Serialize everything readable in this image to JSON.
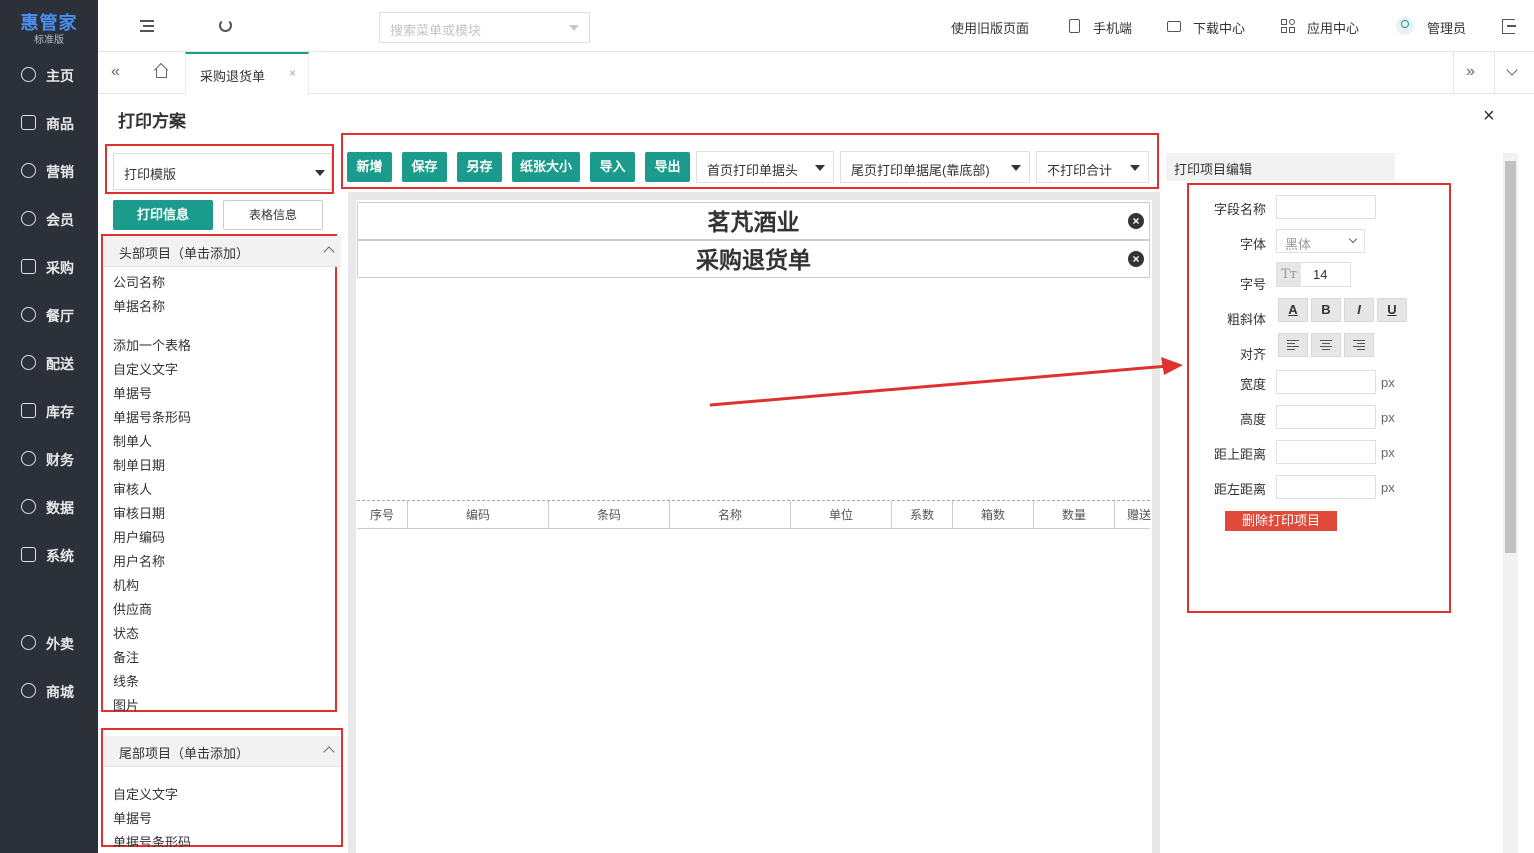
{
  "app": {
    "logo": "惠管家",
    "edition": "标准版"
  },
  "nav": [
    {
      "label": "主页",
      "icon": "home-icon"
    },
    {
      "label": "商品",
      "icon": "box-icon"
    },
    {
      "label": "营销",
      "icon": "marketing-icon"
    },
    {
      "label": "会员",
      "icon": "heart-icon"
    },
    {
      "label": "采购",
      "icon": "purchase-icon"
    },
    {
      "label": "餐厅",
      "icon": "restaurant-icon"
    },
    {
      "label": "配送",
      "icon": "delivery-icon"
    },
    {
      "label": "库存",
      "icon": "inventory-icon"
    },
    {
      "label": "财务",
      "icon": "finance-icon"
    },
    {
      "label": "数据",
      "icon": "chart-icon"
    },
    {
      "label": "系统",
      "icon": "settings-icon"
    },
    {
      "label": "外卖",
      "icon": "takeout-icon"
    },
    {
      "label": "商城",
      "icon": "store-icon"
    }
  ],
  "topbar": {
    "search_placeholder": "搜索菜单或模块",
    "old_version": "使用旧版页面",
    "mobile": "手机端",
    "download": "下载中心",
    "apps": "应用中心",
    "user": "管理员"
  },
  "tabs": {
    "active": "采购退货单",
    "close": "×"
  },
  "dialog": {
    "title": "打印方案",
    "close": "×",
    "template_select": "打印模版",
    "print_info_btn": "打印信息",
    "table_info_btn": "表格信息",
    "header_section": "头部项目（单击添加）",
    "header_items": [
      "公司名称",
      "单据名称",
      "添加一个表格",
      "自定义文字",
      "单据号",
      "单据号条形码",
      "制单人",
      "制单日期",
      "审核人",
      "审核日期",
      "用户编码",
      "用户名称",
      "机构",
      "供应商",
      "状态",
      "备注",
      "线条",
      "图片"
    ],
    "footer_section": "尾部项目（单击添加）",
    "footer_items": [
      "自定义文字",
      "单据号",
      "单据号条形码"
    ]
  },
  "toolbar": {
    "add": "新增",
    "save": "保存",
    "save_as": "另存",
    "paper_size": "纸张大小",
    "import": "导入",
    "export": "导出",
    "first_page_header": "首页打印单据头",
    "last_page_footer": "尾页打印单据尾(靠底部)",
    "no_total": "不打印合计"
  },
  "canvas": {
    "company": "茗芃酒业",
    "doc_name": "采购退货单",
    "columns": [
      "序号",
      "编码",
      "条码",
      "名称",
      "单位",
      "系数",
      "箱数",
      "数量",
      "赠送"
    ]
  },
  "editor": {
    "title": "打印项目编辑",
    "field_name": "字段名称",
    "font": "字体",
    "font_value": "黑体",
    "font_size": "字号",
    "font_size_value": "14",
    "style": "粗斜体",
    "align": "对齐",
    "width": "宽度",
    "height": "高度",
    "top": "距上距离",
    "left": "距左距离",
    "unit": "px",
    "bold_a": "A",
    "bold_b": "B",
    "italic": "I",
    "underline": "U",
    "delete": "删除打印项目"
  },
  "colors": {
    "accent": "#1a9b8c",
    "sidebar": "#2b3039",
    "highlight": "#e03030"
  }
}
